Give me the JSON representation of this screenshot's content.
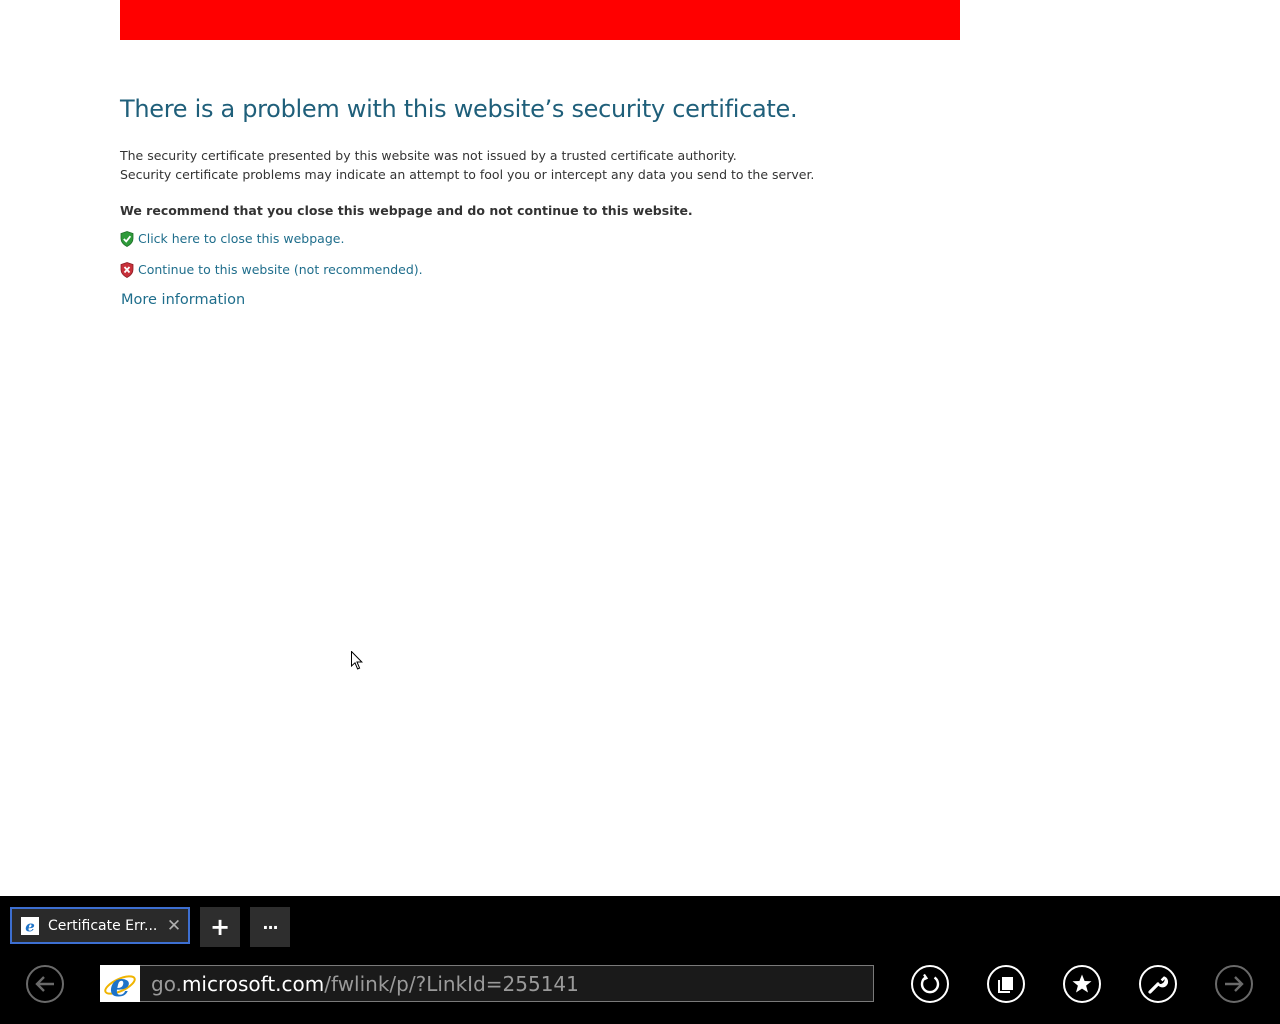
{
  "colors": {
    "banner": "#ff0000",
    "headline": "#1f5f7a",
    "link": "#1f6e8c",
    "appbar": "#000000",
    "tab_border": "#3d6fd1"
  },
  "page": {
    "headline": "There is a problem with this website’s security certificate.",
    "desc_line1": "The security certificate presented by this website was not issued by a trusted certificate authority.",
    "desc_line2": "Security certificate problems may indicate an attempt to fool you or intercept any data you send to the server.",
    "recommend": "We recommend that you close this webpage and do not continue to this website.",
    "close_link": "Click here to close this webpage.",
    "continue_link": "Continue to this website (not recommended).",
    "more_info": "More information"
  },
  "appbar": {
    "tab": {
      "title": "Certificate Err...",
      "close_glyph": "✕",
      "icon": "ie-favicon-icon"
    },
    "new_tab_glyph": "+",
    "tab_tools_glyph": "···",
    "address": {
      "prefix": "go.",
      "host": "microsoft.com",
      "path": "/fwlink/p/?LinkId=255141"
    },
    "buttons": {
      "back": "back-arrow-icon",
      "refresh": "refresh-icon",
      "pin": "pin-to-start-icon",
      "favorites": "star-icon",
      "page_tools": "wrench-icon",
      "forward": "forward-arrow-icon"
    }
  }
}
